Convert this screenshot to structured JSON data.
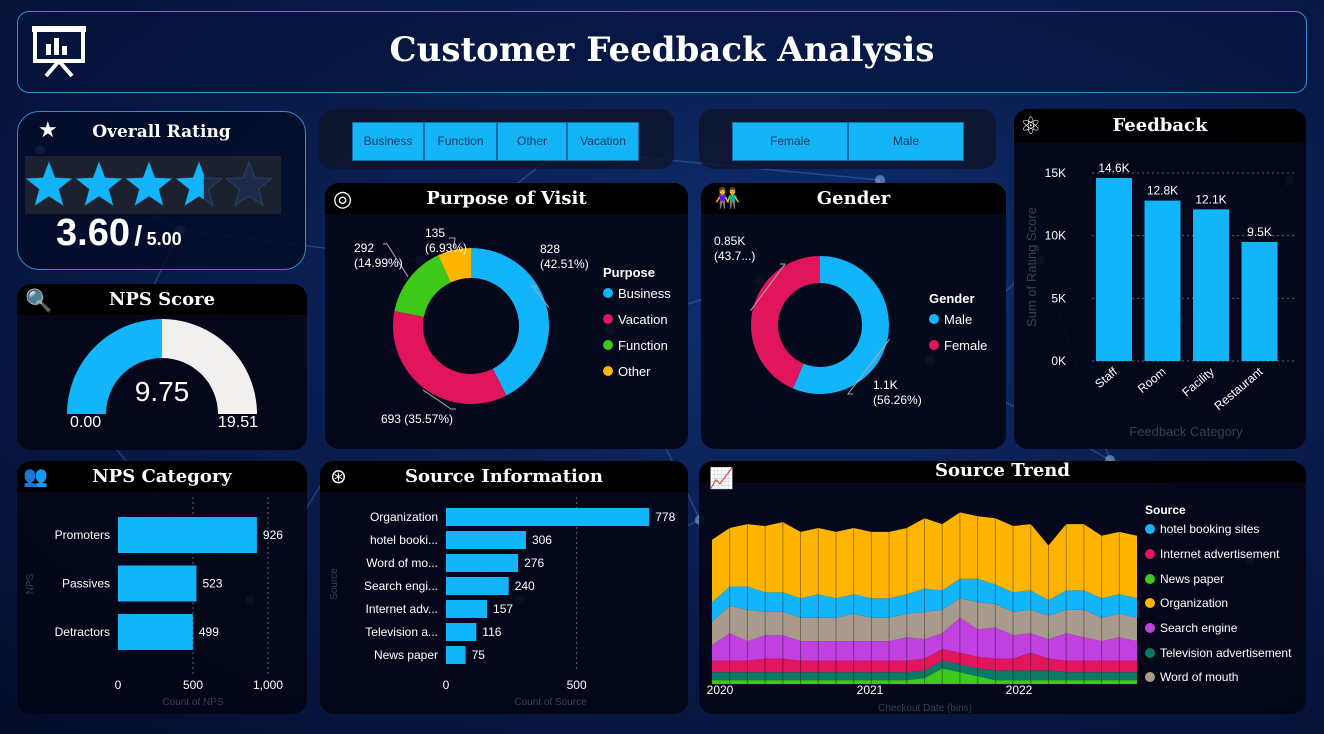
{
  "header": {
    "title": "Customer Feedback Analysis",
    "icon": "presentation-chart-icon"
  },
  "overall_rating": {
    "title": "Overall Rating",
    "stars_filled": 3.6,
    "stars_total": 5,
    "value": "3.60",
    "separator": "/",
    "max": "5.00"
  },
  "nps_score": {
    "title": "NPS Score",
    "value": "9.75",
    "min": "0.00",
    "max": "19.51",
    "fill_fraction": 0.5
  },
  "purpose_slicer": {
    "options": [
      "Business",
      "Function",
      "Other",
      "Vacation"
    ]
  },
  "gender_slicer": {
    "options": [
      "Female",
      "Male"
    ]
  },
  "colors": {
    "blue": "#12b5fa",
    "pink": "#e0155c",
    "green": "#3ec81a",
    "orange": "#ffb400",
    "purple": "#c040e0",
    "teal": "#0a7a66",
    "taupe": "#a89a8c"
  },
  "chart_data": [
    {
      "id": "purpose",
      "type": "pie",
      "title": "Purpose of Visit",
      "legend_title": "Purpose",
      "legend_position": "right",
      "slices": [
        {
          "name": "Business",
          "value": 828,
          "label": "828\n(42.51%)",
          "color": "#12b5fa"
        },
        {
          "name": "Vacation",
          "value": 693,
          "label": "693 (35.57%)",
          "color": "#e0155c"
        },
        {
          "name": "Function",
          "value": 292,
          "label": "292\n(14.99%)",
          "color": "#3ec81a"
        },
        {
          "name": "Other",
          "value": 135,
          "label": "135\n(6.93%)",
          "color": "#ffb400"
        }
      ]
    },
    {
      "id": "gender",
      "type": "pie",
      "title": "Gender",
      "legend_title": "Gender",
      "legend_position": "right",
      "slices": [
        {
          "name": "Male",
          "value": 1100,
          "label": "1.1K\n(56.26%)",
          "color": "#12b5fa"
        },
        {
          "name": "Female",
          "value": 850,
          "label": "0.85K\n(43.7...)",
          "color": "#e0155c"
        }
      ]
    },
    {
      "id": "feedback",
      "type": "bar",
      "title": "Feedback",
      "categories": [
        "Staff",
        "Room",
        "Facility",
        "Restaurant"
      ],
      "values": [
        14600,
        12800,
        12100,
        9500
      ],
      "data_labels": [
        "14.6K",
        "12.8K",
        "12.1K",
        "9.5K"
      ],
      "ylabel": "Sum of Rating Score",
      "xlabel": "Feedback Category",
      "ylim": [
        0,
        15000
      ],
      "yticks": [
        {
          "v": 0,
          "t": "0K"
        },
        {
          "v": 5000,
          "t": "5K"
        },
        {
          "v": 10000,
          "t": "10K"
        },
        {
          "v": 15000,
          "t": "15K"
        }
      ]
    },
    {
      "id": "nps_category",
      "type": "bar",
      "orientation": "horizontal",
      "title": "NPS Category",
      "categories": [
        "Promoters",
        "Passives",
        "Detractors"
      ],
      "values": [
        926,
        523,
        499
      ],
      "xlabel": "Count of NPS",
      "ylabel": "NPS",
      "xlim": [
        0,
        1000
      ],
      "xticks": [
        {
          "v": 0,
          "t": "0"
        },
        {
          "v": 500,
          "t": "500"
        },
        {
          "v": 1000,
          "t": "1,000"
        }
      ]
    },
    {
      "id": "source_info",
      "type": "bar",
      "orientation": "horizontal",
      "title": "Source Information",
      "categories": [
        "Organization",
        "hotel booki...",
        "Word of mo...",
        "Search engi...",
        "Internet adv...",
        "Television a...",
        "News paper"
      ],
      "values": [
        778,
        306,
        276,
        240,
        157,
        116,
        75
      ],
      "xlabel": "Count of Source",
      "ylabel": "Source",
      "xlim": [
        0,
        800
      ],
      "xticks": [
        {
          "v": 0,
          "t": "0"
        },
        {
          "v": 500,
          "t": "500"
        }
      ]
    },
    {
      "id": "source_trend",
      "type": "area",
      "title": "Source Trend",
      "legend_title": "Source",
      "legend_position": "right",
      "xlabel": "Checkout Date (bins)",
      "x_ticks": [
        "2020",
        "2021",
        "2022"
      ],
      "series": [
        {
          "name": "News paper",
          "color": "#3ec81a",
          "values": [
            2,
            2,
            2,
            2,
            2,
            2,
            2,
            2,
            2,
            2,
            2,
            2,
            3,
            8,
            6,
            4,
            2,
            2,
            2,
            2,
            2,
            2,
            2,
            2,
            2
          ]
        },
        {
          "name": "Television advertisement",
          "color": "#0a7a66",
          "values": [
            4,
            4,
            4,
            4,
            4,
            4,
            4,
            4,
            4,
            4,
            4,
            4,
            4,
            4,
            4,
            4,
            5,
            5,
            5,
            5,
            4,
            4,
            4,
            4,
            4
          ]
        },
        {
          "name": "Internet advertisement",
          "color": "#e0155c",
          "values": [
            6,
            6,
            6,
            7,
            7,
            6,
            6,
            6,
            6,
            6,
            6,
            6,
            6,
            6,
            6,
            6,
            6,
            6,
            9,
            6,
            6,
            6,
            6,
            6,
            6
          ]
        },
        {
          "name": "Search engine",
          "color": "#c040e0",
          "values": [
            8,
            14,
            10,
            12,
            12,
            10,
            10,
            10,
            10,
            10,
            10,
            12,
            10,
            8,
            18,
            14,
            16,
            12,
            10,
            10,
            14,
            12,
            10,
            12,
            10
          ]
        },
        {
          "name": "Word of mouth",
          "color": "#a89a8c",
          "values": [
            12,
            14,
            16,
            12,
            12,
            12,
            12,
            12,
            14,
            12,
            12,
            12,
            14,
            12,
            10,
            14,
            12,
            12,
            12,
            12,
            12,
            14,
            12,
            12,
            12
          ]
        },
        {
          "name": "hotel booking sites",
          "color": "#12b5fa",
          "values": [
            10,
            10,
            12,
            10,
            10,
            10,
            12,
            10,
            10,
            10,
            10,
            10,
            12,
            10,
            10,
            12,
            10,
            10,
            10,
            8,
            10,
            10,
            10,
            10,
            10
          ]
        },
        {
          "name": "Organization",
          "color": "#ffb400",
          "values": [
            32,
            30,
            32,
            34,
            36,
            34,
            34,
            34,
            34,
            34,
            34,
            34,
            36,
            34,
            34,
            32,
            34,
            34,
            34,
            28,
            34,
            34,
            32,
            32,
            32
          ]
        }
      ]
    }
  ]
}
